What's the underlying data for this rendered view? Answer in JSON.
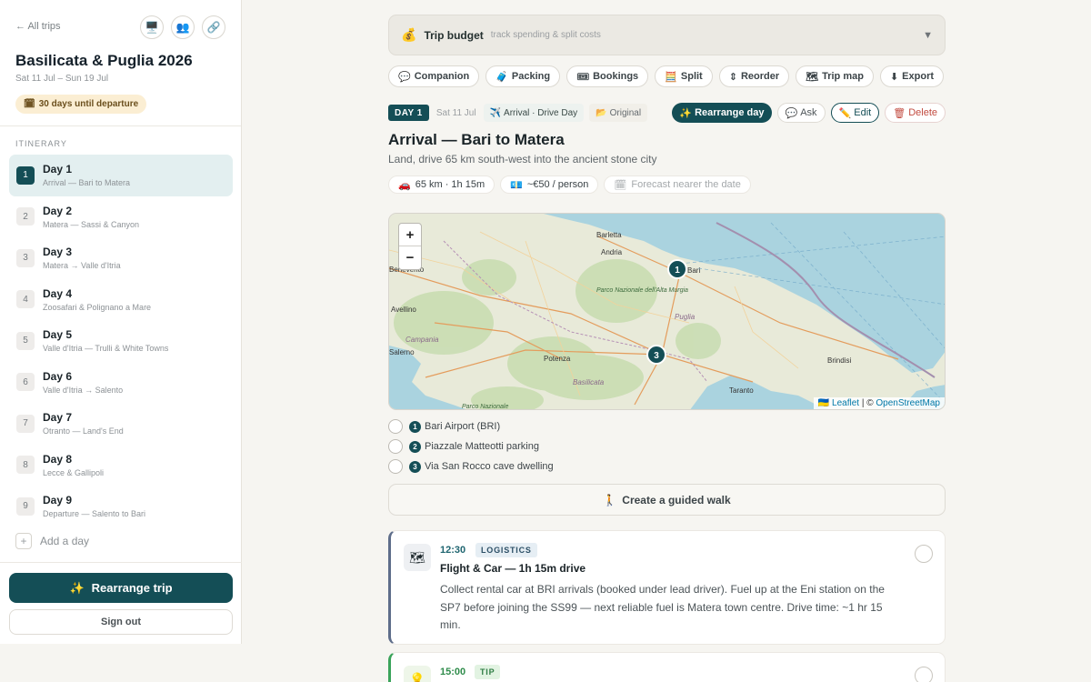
{
  "sidebar": {
    "back_label": "← All trips",
    "top_icons": [
      "desktop-icon",
      "people-icon",
      "link-icon"
    ],
    "trip_title": "Basilicata & Puglia 2026",
    "trip_dates": "Sat 11 Jul – Sun 19 Jul",
    "countdown": "30 days until departure",
    "itinerary_label": "ITINERARY",
    "days": [
      {
        "num": "1",
        "name": "Day 1",
        "sub": "Arrival — Bari to Matera",
        "active": true
      },
      {
        "num": "2",
        "name": "Day 2",
        "sub": "Matera — Sassi & Canyon"
      },
      {
        "num": "3",
        "name": "Day 3",
        "sub": "Matera → Valle d'Itria"
      },
      {
        "num": "4",
        "name": "Day 4",
        "sub": "Zoosafari & Polignano a Mare"
      },
      {
        "num": "5",
        "name": "Day 5",
        "sub": "Valle d'Itria — Trulli & White Towns"
      },
      {
        "num": "6",
        "name": "Day 6",
        "sub": "Valle d'Itria → Salento"
      },
      {
        "num": "7",
        "name": "Day 7",
        "sub": "Otranto — Land's End"
      },
      {
        "num": "8",
        "name": "Day 8",
        "sub": "Lecce & Gallipoli"
      },
      {
        "num": "9",
        "name": "Day 9",
        "sub": "Departure — Salento to Bari"
      }
    ],
    "add_day": "Add a day",
    "rearrange_trip": "Rearrange trip",
    "sign_out": "Sign out"
  },
  "budget": {
    "title": "Trip budget",
    "subtitle": "track spending & split costs"
  },
  "tools": [
    {
      "icon": "💬",
      "label": "Companion"
    },
    {
      "icon": "🧳",
      "label": "Packing"
    },
    {
      "icon": "🎟",
      "label": "Bookings"
    },
    {
      "icon": "🧮",
      "label": "Split"
    },
    {
      "icon": "⇕",
      "label": "Reorder"
    },
    {
      "icon": "🗺",
      "label": "Trip map"
    },
    {
      "icon": "⬇",
      "label": "Export"
    }
  ],
  "day": {
    "badge": "DAY 1",
    "date": "Sat 11 Jul",
    "type": "Arrival · Drive Day",
    "original": "Original",
    "actions": {
      "rearrange": "Rearrange day",
      "ask": "Ask",
      "edit": "Edit",
      "delete": "Delete"
    },
    "title": "Arrival — Bari to Matera",
    "description": "Land, drive 65 km south-west into the ancient stone city",
    "stats": {
      "drive": "65 km · 1h 15m",
      "cost": "~€50 / person",
      "weather": "Forecast nearer the date"
    }
  },
  "map": {
    "zoom_in": "+",
    "zoom_out": "−",
    "attribution_leaflet": "Leaflet",
    "attribution_sep": " | © ",
    "attribution_osm": "OpenStreetMap",
    "places": [
      "Barletta",
      "Andria",
      "Bari",
      "Benevento",
      "Avellino",
      "Parco Nazionale dell'Alta Murgia",
      "Puglia",
      "Campania",
      "Salerno",
      "Potenza",
      "Basilicata",
      "Brindisi",
      "Taranto",
      "Parco Nazionale"
    ],
    "markers": [
      "1",
      "3"
    ]
  },
  "stops": [
    {
      "n": "1",
      "label": "Bari Airport (BRI)"
    },
    {
      "n": "2",
      "label": "Piazzale Matteotti parking"
    },
    {
      "n": "3",
      "label": "Via San Rocco cave dwelling"
    }
  ],
  "walk_button": "Create a guided walk",
  "cards": [
    {
      "time": "12:30",
      "tag": "LOGISTICS",
      "title": "Flight & Car — 1h 15m drive",
      "body": "Collect rental car at BRI arrivals (booked under lead driver). Fuel up at the Eni station on the SP7 before joining the SS99 — next reliable fuel is Matera town centre. Drive time: ~1 hr 15 min."
    },
    {
      "time": "15:00",
      "tag": "TIP"
    }
  ],
  "colors": {
    "accent": "#144e56",
    "logistics": "#5e6d8a",
    "tip": "#3aa35a",
    "delete": "#c24b40"
  }
}
